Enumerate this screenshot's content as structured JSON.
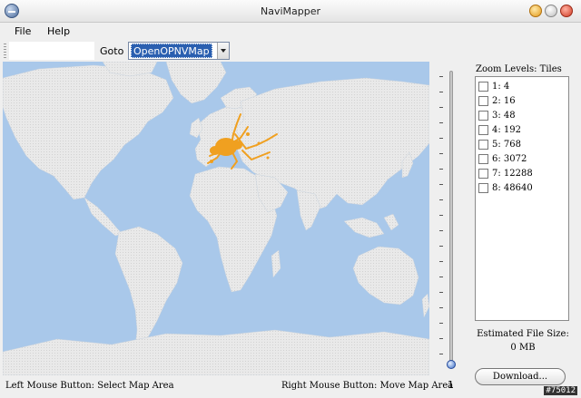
{
  "window": {
    "title": "NaviMapper"
  },
  "menu": {
    "file": "File",
    "help": "Help"
  },
  "toolbar": {
    "goto_label": "Goto",
    "map_source": "OpenOPNVMap"
  },
  "slider": {
    "value": "1"
  },
  "zoom": {
    "title": "Zoom Levels: Tiles",
    "levels": [
      {
        "label": "1: 4"
      },
      {
        "label": "2: 16"
      },
      {
        "label": "3: 48"
      },
      {
        "label": "4: 192"
      },
      {
        "label": "5: 768"
      },
      {
        "label": "6: 3072"
      },
      {
        "label": "7: 12288"
      },
      {
        "label": "8: 48640"
      }
    ]
  },
  "estimate": {
    "label": "Estimated File Size:",
    "value": "0 MB"
  },
  "download": {
    "label": "Download..."
  },
  "status": {
    "left": "Left Mouse Button: Select Map Area",
    "right": "Right Mouse Button: Move Map Area"
  },
  "watermark": "#75012",
  "colors": {
    "ocean": "#a9c8ea",
    "land": "#e8e8e8",
    "coverage": "#f0a020",
    "selection": "#2a5fb0"
  }
}
